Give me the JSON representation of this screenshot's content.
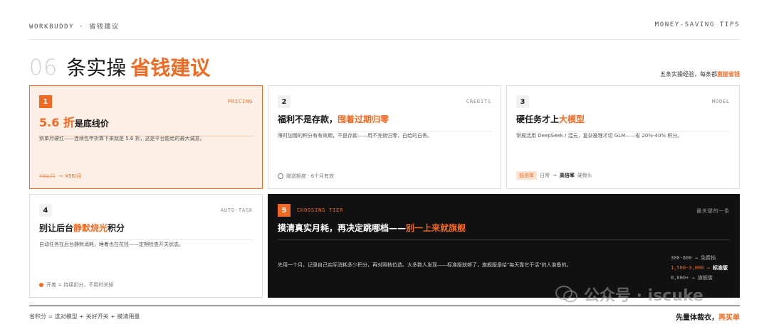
{
  "header": {
    "left": "WORKBUDDY · 省钱建议",
    "right": "MONEY-SAVING TIPS"
  },
  "headline": {
    "number": "06",
    "prefix": "条实操",
    "highlight": "省钱建议"
  },
  "tagline": {
    "text": "五条实操经验，每条都",
    "highlight": "直接省钱"
  },
  "cards": [
    {
      "index": "1",
      "tag": "PRICING",
      "title_highlight": "5.6 折",
      "title": "是底线价",
      "desc": "别单月硬扛——连续包年折算下来就是 5.6 折，这是平台能给的最大诚意。",
      "foot_old": "¥99/月",
      "foot_arrow": "→",
      "foot_new": "¥56/月"
    },
    {
      "index": "2",
      "tag": "CREDITS",
      "title": "福利不是存款，",
      "title_highlight": "囤着过期归零",
      "desc": "限时加赠的积分有有效期，不是存款——用不完就归零，白给的白丢。",
      "foot": "赠送额度 · 6个月有效"
    },
    {
      "index": "3",
      "tag": "MODEL",
      "title": "硬任务才上",
      "title_highlight": "大模型",
      "desc": "常规活用 DeepSeek / 混元，复杂推理才切 GLM——省 20%-40% 积分。",
      "foot_pill": "低倍率",
      "foot_a": "日常",
      "foot_arrow": "→",
      "foot_b": "高倍率",
      "foot_c": "硬骨头"
    },
    {
      "index": "4",
      "tag": "AUTO-TASK",
      "title": "别让后台",
      "title_highlight": "静默烧光",
      "title_suffix": "积分",
      "desc": "自动任务在后台静默消耗，睡着也在花钱——定期检查开关状态。",
      "foot": "开着 = 持续扣分，不用时关掉"
    },
    {
      "index": "5",
      "tag": "CHOOSING TIER",
      "tag_right": "最关键的一条",
      "title": "摸清真实月耗，再决定跳哪档——",
      "title_highlight": "别一上来就旗舰",
      "desc": "先用一个月，记录自己实际消耗多少积分，再对照档位选。大多数人发现——标准版就够了，旗舰版是给\"每天靠它干活\"的人准备的。",
      "tiers": [
        {
          "range": "300-600",
          "arrow": "→",
          "label": "免费档"
        },
        {
          "range": "1,500-3,000",
          "arrow": "→",
          "label": "标准版"
        },
        {
          "range": "8,000+",
          "arrow": "→",
          "label": "旗舰版"
        }
      ]
    }
  ],
  "footer": {
    "left": "省积分 = 选对模型 + 关好开关 + 摸清用量",
    "right": "先量体裁衣，",
    "right_highlight": "再买单"
  },
  "watermark": {
    "text": "公众号 · iscuke"
  },
  "colors": {
    "accent": "#f26a21",
    "dark": "#111111",
    "highlight_bg": "#fdefe6"
  },
  "icons": {
    "card2_foot": "clock-icon",
    "card4_foot": "dot-icon",
    "watermark": "wechat-icon"
  }
}
